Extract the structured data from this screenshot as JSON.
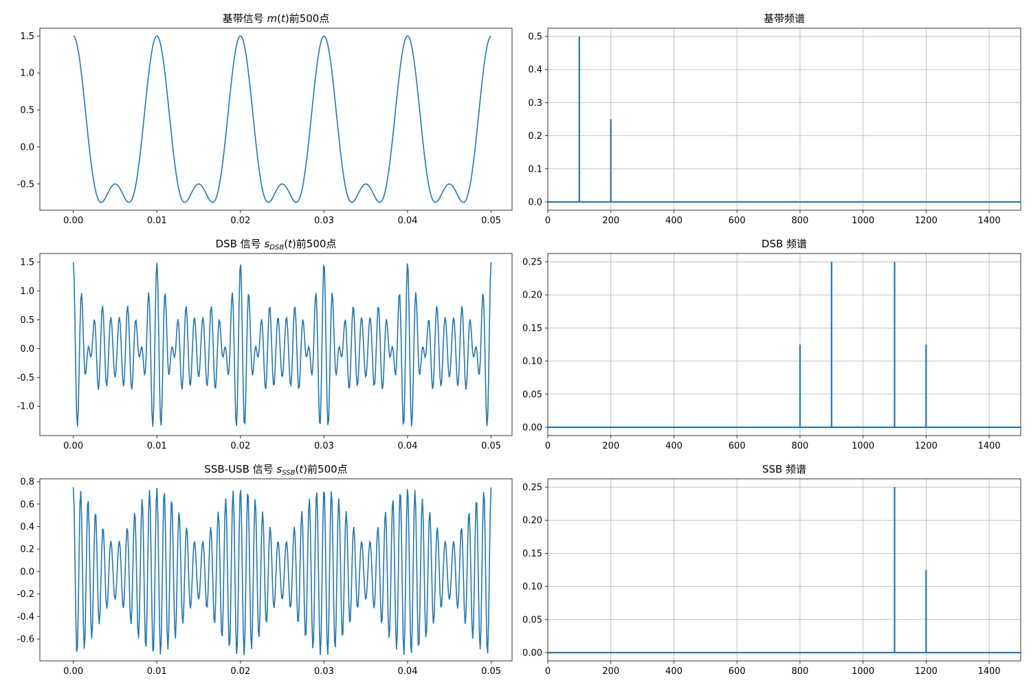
{
  "chart_data": [
    {
      "id": "baseband",
      "type": "line",
      "title": "基带信号 m(t)前500点",
      "title_parts": [
        {
          "text": "基带信号 ",
          "style": "normal"
        },
        {
          "text": "m",
          "style": "italic"
        },
        {
          "text": "(",
          "style": "normal"
        },
        {
          "text": "t",
          "style": "italic"
        },
        {
          "text": ")前500点",
          "style": "normal"
        }
      ],
      "xlabel": "",
      "ylabel": "",
      "xlim": [
        -0.004,
        0.0525
      ],
      "ylim": [
        -0.855,
        1.605
      ],
      "xticks": [
        0,
        0.01,
        0.02,
        0.03,
        0.04,
        0.05
      ],
      "xtick_labels": [
        "0.00",
        "0.01",
        "0.02",
        "0.03",
        "0.04",
        "0.05"
      ],
      "yticks": [
        -0.5,
        0,
        0.5,
        1.0,
        1.5
      ],
      "ytick_labels": [
        "-0.5",
        "0.0",
        "0.5",
        "1.0",
        "1.5"
      ],
      "grid": false,
      "color": "#1f77b4",
      "series": [
        {
          "t_start": 0,
          "t_end": 0.04999,
          "num_points": 500,
          "components": [
            {
              "amplitude": 1.0,
              "freq": 100,
              "phase": "cos"
            },
            {
              "amplitude": 0.5,
              "freq": 200,
              "phase": "cos"
            }
          ]
        }
      ]
    },
    {
      "id": "baseband-spectrum",
      "type": "line",
      "title": "基带频谱",
      "title_parts": [
        {
          "text": "基带频谱",
          "style": "normal"
        }
      ],
      "xlabel": "",
      "ylabel": "",
      "xlim": [
        0,
        1500
      ],
      "ylim": [
        -0.025,
        0.525
      ],
      "xticks": [
        0,
        200,
        400,
        600,
        800,
        1000,
        1200,
        1400
      ],
      "xtick_labels": [
        "0",
        "200",
        "400",
        "600",
        "800",
        "1000",
        "1200",
        "1400"
      ],
      "yticks": [
        0,
        0.1,
        0.2,
        0.3,
        0.4,
        0.5
      ],
      "ytick_labels": [
        "0.0",
        "0.1",
        "0.2",
        "0.3",
        "0.4",
        "0.5"
      ],
      "grid": true,
      "color": "#1f77b4",
      "peaks": [
        {
          "x": 100,
          "y": 0.5
        },
        {
          "x": 200,
          "y": 0.25
        }
      ]
    },
    {
      "id": "dsb",
      "type": "line",
      "title": "DSB 信号 sDSB(t)前500点",
      "title_parts": [
        {
          "text": "DSB 信号 ",
          "style": "normal"
        },
        {
          "text": "s",
          "style": "italic"
        },
        {
          "text": "DSB",
          "style": "sub"
        },
        {
          "text": "(",
          "style": "normal"
        },
        {
          "text": "t",
          "style": "italic"
        },
        {
          "text": ")前500点",
          "style": "normal"
        }
      ],
      "xlabel": "",
      "ylabel": "",
      "xlim": [
        -0.004,
        0.0525
      ],
      "ylim": [
        -1.51,
        1.65
      ],
      "xticks": [
        0,
        0.01,
        0.02,
        0.03,
        0.04,
        0.05
      ],
      "xtick_labels": [
        "0.00",
        "0.01",
        "0.02",
        "0.03",
        "0.04",
        "0.05"
      ],
      "yticks": [
        -1.0,
        -0.5,
        0,
        0.5,
        1.0,
        1.5
      ],
      "ytick_labels": [
        "-1.0",
        "-0.5",
        "0.0",
        "0.5",
        "1.0",
        "1.5"
      ],
      "grid": false,
      "color": "#1f77b4",
      "series": [
        {
          "t_start": 0,
          "t_end": 0.04999,
          "num_points": 500,
          "components": [
            {
              "amplitude": 0.25,
              "freq": 800,
              "phase": "cos"
            },
            {
              "amplitude": 0.5,
              "freq": 900,
              "phase": "cos"
            },
            {
              "amplitude": 0.5,
              "freq": 1100,
              "phase": "cos"
            },
            {
              "amplitude": 0.25,
              "freq": 1200,
              "phase": "cos"
            }
          ]
        }
      ]
    },
    {
      "id": "dsb-spectrum",
      "type": "line",
      "title": "DSB 频谱",
      "title_parts": [
        {
          "text": "DSB 频谱",
          "style": "normal"
        }
      ],
      "xlabel": "",
      "ylabel": "",
      "xlim": [
        0,
        1500
      ],
      "ylim": [
        -0.0125,
        0.2625
      ],
      "xticks": [
        0,
        200,
        400,
        600,
        800,
        1000,
        1200,
        1400
      ],
      "xtick_labels": [
        "0",
        "200",
        "400",
        "600",
        "800",
        "1000",
        "1200",
        "1400"
      ],
      "yticks": [
        0,
        0.05,
        0.1,
        0.15,
        0.2,
        0.25
      ],
      "ytick_labels": [
        "0.00",
        "0.05",
        "0.10",
        "0.15",
        "0.20",
        "0.25"
      ],
      "grid": true,
      "color": "#1f77b4",
      "peaks": [
        {
          "x": 800,
          "y": 0.125
        },
        {
          "x": 900,
          "y": 0.25
        },
        {
          "x": 1100,
          "y": 0.25
        },
        {
          "x": 1200,
          "y": 0.125
        }
      ]
    },
    {
      "id": "ssb",
      "type": "line",
      "title": "SSB-USB 信号 sSSB(t)前500点",
      "title_parts": [
        {
          "text": "SSB-USB 信号 ",
          "style": "normal"
        },
        {
          "text": "s",
          "style": "italic"
        },
        {
          "text": "SSB",
          "style": "sub"
        },
        {
          "text": "(",
          "style": "normal"
        },
        {
          "text": "t",
          "style": "italic"
        },
        {
          "text": ")前500点",
          "style": "normal"
        }
      ],
      "xlabel": "",
      "ylabel": "",
      "xlim": [
        -0.004,
        0.0525
      ],
      "ylim": [
        -0.795,
        0.825
      ],
      "xticks": [
        0,
        0.01,
        0.02,
        0.03,
        0.04,
        0.05
      ],
      "xtick_labels": [
        "0.00",
        "0.01",
        "0.02",
        "0.03",
        "0.04",
        "0.05"
      ],
      "yticks": [
        -0.6,
        -0.4,
        -0.2,
        0,
        0.2,
        0.4,
        0.6,
        0.8
      ],
      "ytick_labels": [
        "-0.6",
        "-0.4",
        "-0.2",
        "0.0",
        "0.2",
        "0.4",
        "0.6",
        "0.8"
      ],
      "grid": false,
      "color": "#1f77b4",
      "series": [
        {
          "t_start": 0,
          "t_end": 0.04999,
          "num_points": 500,
          "components": [
            {
              "amplitude": 0.5,
              "freq": 1100,
              "phase": "cos"
            },
            {
              "amplitude": 0.25,
              "freq": 1200,
              "phase": "cos"
            }
          ]
        }
      ]
    },
    {
      "id": "ssb-spectrum",
      "type": "line",
      "title": "SSB 频谱",
      "title_parts": [
        {
          "text": "SSB 频谱",
          "style": "normal"
        }
      ],
      "xlabel": "",
      "ylabel": "",
      "xlim": [
        0,
        1500
      ],
      "ylim": [
        -0.0125,
        0.2625
      ],
      "xticks": [
        0,
        200,
        400,
        600,
        800,
        1000,
        1200,
        1400
      ],
      "xtick_labels": [
        "0",
        "200",
        "400",
        "600",
        "800",
        "1000",
        "1200",
        "1400"
      ],
      "yticks": [
        0,
        0.05,
        0.1,
        0.15,
        0.2,
        0.25
      ],
      "ytick_labels": [
        "0.00",
        "0.05",
        "0.10",
        "0.15",
        "0.20",
        "0.25"
      ],
      "grid": true,
      "color": "#1f77b4",
      "peaks": [
        {
          "x": 1100,
          "y": 0.25
        },
        {
          "x": 1200,
          "y": 0.125
        }
      ]
    }
  ]
}
